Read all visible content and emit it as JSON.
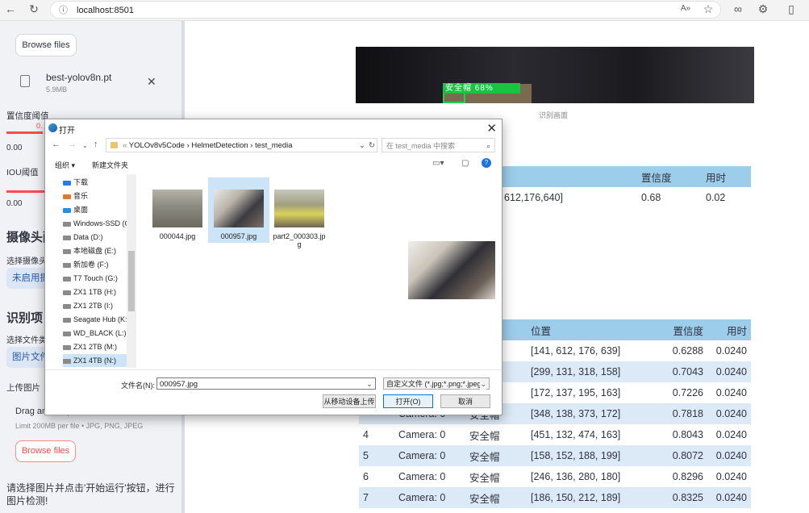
{
  "browser": {
    "url": "localhost:8501"
  },
  "sidebar": {
    "top_browse_label": "Browse files",
    "model_file": {
      "name": "best-yolov8n.pt",
      "size": "5.9MB"
    },
    "conf": {
      "label": "置信度阈值",
      "value_tag": "0.",
      "value": "0.00"
    },
    "iou": {
      "label": "IOU阈值",
      "value": "0.00"
    },
    "camera_heading": "摄像头配",
    "camera_select_label": "选择摄像头",
    "camera_select_value": "未启用摄",
    "project_heading": "识别项目",
    "file_type_label": "选择文件类",
    "file_type_value": "图片文件",
    "upload_label": "上传图片",
    "drag_text": "Drag and drop file here",
    "limit_text": "Limit 200MB per file • JPG, PNG, JPEG",
    "browse_label": "Browse files",
    "status_message": "请选择图片并点击'开始运行'按钮，进行图片检测!"
  },
  "main": {
    "image_overlay_label": "安全帽 68%",
    "image_caption": "识别画面",
    "summary_table": {
      "headers": [
        "",
        "置信度",
        "用时"
      ],
      "row": [
        "612,176,640]",
        "0.68",
        "0.02"
      ]
    },
    "results_table": {
      "headers": [
        "",
        "",
        "果",
        "位置",
        "置信度",
        "用时"
      ],
      "rows": [
        [
          "",
          "",
          "",
          "[141, 612, 176, 639]",
          "0.6288",
          "0.0240"
        ],
        [
          "",
          "",
          "",
          "[299, 131, 318, 158]",
          "0.7043",
          "0.0240"
        ],
        [
          "",
          "",
          "",
          "[172, 137, 195, 163]",
          "0.7226",
          "0.0240"
        ],
        [
          "",
          "Camera: 0",
          "安全帽",
          "[348, 138, 373, 172]",
          "0.7818",
          "0.0240"
        ],
        [
          "4",
          "Camera: 0",
          "安全帽",
          "[451, 132, 474, 163]",
          "0.8043",
          "0.0240"
        ],
        [
          "5",
          "Camera: 0",
          "安全帽",
          "[158, 152, 188, 199]",
          "0.8072",
          "0.0240"
        ],
        [
          "6",
          "Camera: 0",
          "安全帽",
          "[246, 136, 280, 180]",
          "0.8296",
          "0.0240"
        ],
        [
          "7",
          "Camera: 0",
          "安全帽",
          "[186, 150, 212, 189]",
          "0.8325",
          "0.0240"
        ]
      ]
    }
  },
  "dialog": {
    "title": "打开",
    "breadcrumb": [
      "YOLOv8v5Code",
      "HelmetDetection",
      "test_media"
    ],
    "search_placeholder": "在 test_media 中搜索",
    "organize_label": "组织 ▾",
    "new_folder_label": "新建文件夹",
    "tree": [
      {
        "label": "下载",
        "icon": "download-icon"
      },
      {
        "label": "音乐",
        "icon": "music-icon"
      },
      {
        "label": "桌面",
        "icon": "desktop-icon"
      },
      {
        "label": "Windows-SSD (C",
        "icon": "drive-icon"
      },
      {
        "label": "Data (D:)",
        "icon": "drive-icon"
      },
      {
        "label": "本地磁盘 (E:)",
        "icon": "drive-icon"
      },
      {
        "label": "新加卷 (F:)",
        "icon": "drive-icon"
      },
      {
        "label": "T7 Touch (G:)",
        "icon": "drive-icon"
      },
      {
        "label": "ZX1 1TB (H:)",
        "icon": "drive-icon"
      },
      {
        "label": "ZX1 2TB (I:)",
        "icon": "drive-icon"
      },
      {
        "label": "Seagate Hub (K:",
        "icon": "drive-icon"
      },
      {
        "label": "WD_BLACK (L:)",
        "icon": "drive-icon"
      },
      {
        "label": "ZX1 2TB (M:)",
        "icon": "drive-icon"
      },
      {
        "label": "ZX1 4TB (N:)",
        "icon": "drive-icon"
      }
    ],
    "files": [
      "000044.jpg",
      "000957.jpg",
      "part2_000303.jpg"
    ],
    "filename_label": "文件名(N):",
    "filename_value": "000957.jpg",
    "filetype_value": "自定义文件 (*.jpg;*.png;*.jpeg",
    "mobile_upload_label": "从移动设备上传",
    "open_label": "打开(O)",
    "cancel_label": "取消"
  }
}
